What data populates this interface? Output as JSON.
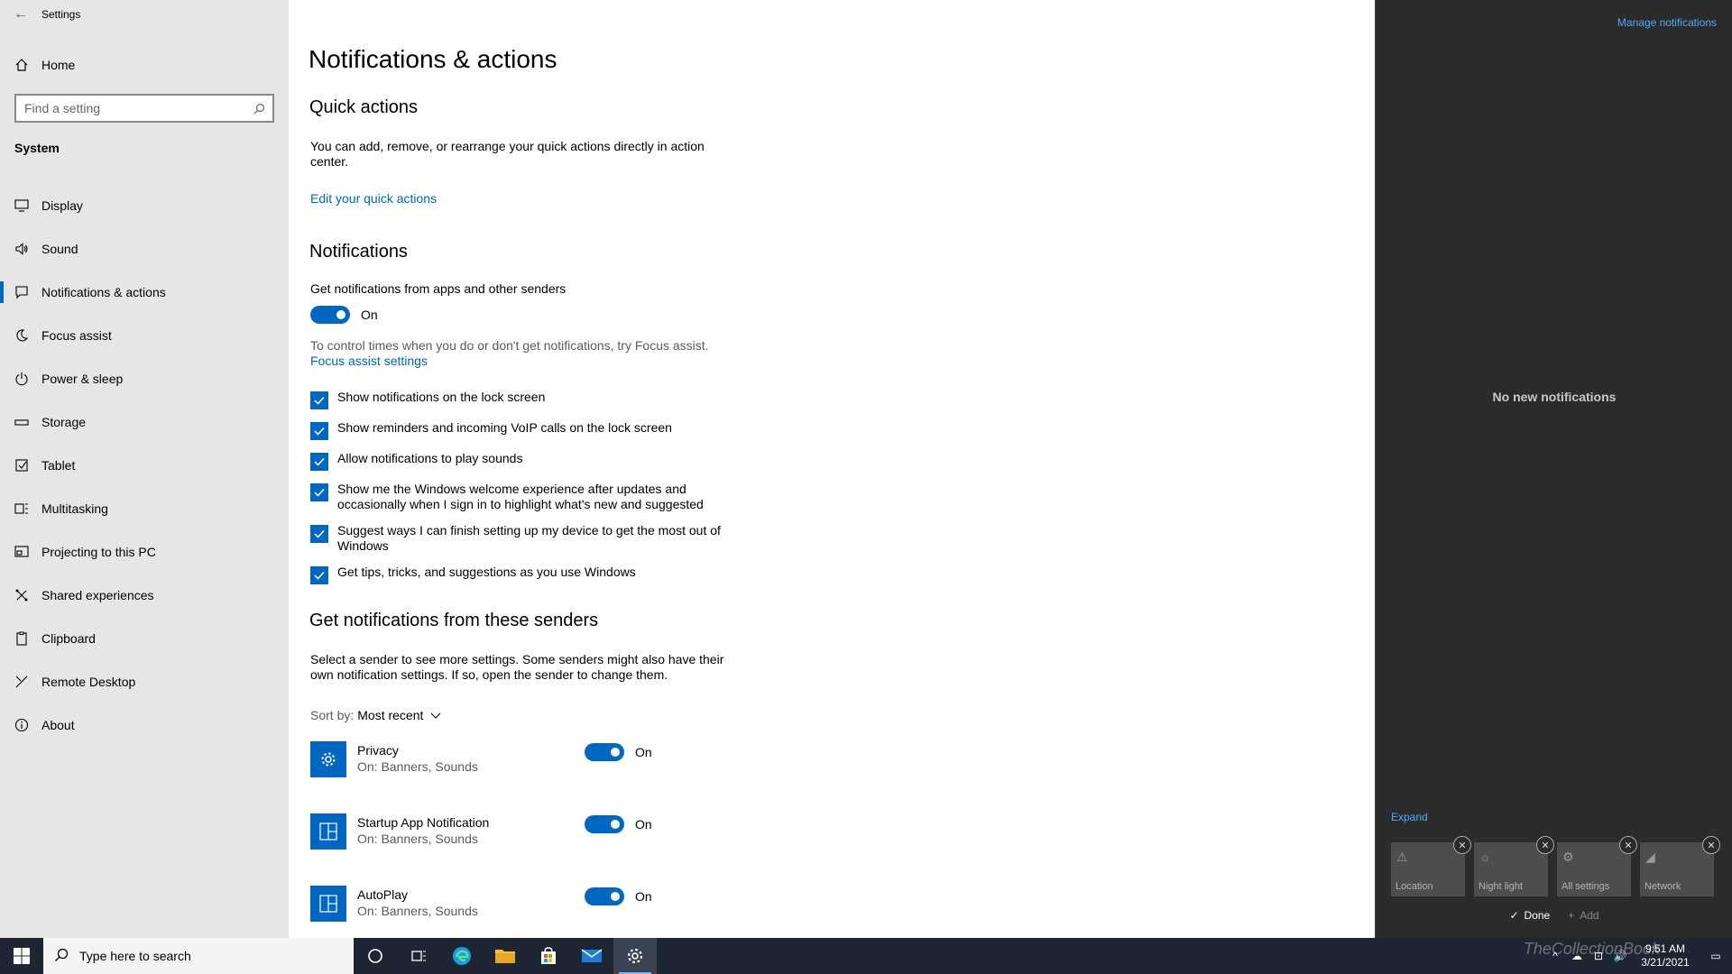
{
  "window": {
    "app_title": "Settings",
    "back_glyph": "←"
  },
  "sidebar": {
    "home_label": "Home",
    "search_placeholder": "Find a setting",
    "section_label": "System",
    "items": [
      {
        "label": "Display",
        "icon": "monitor-icon"
      },
      {
        "label": "Sound",
        "icon": "speaker-icon"
      },
      {
        "label": "Notifications & actions",
        "icon": "message-icon",
        "active": true
      },
      {
        "label": "Focus assist",
        "icon": "moon-icon"
      },
      {
        "label": "Power & sleep",
        "icon": "power-icon"
      },
      {
        "label": "Storage",
        "icon": "drive-icon"
      },
      {
        "label": "Tablet",
        "icon": "tablet-icon"
      },
      {
        "label": "Multitasking",
        "icon": "multitasking-icon"
      },
      {
        "label": "Projecting to this PC",
        "icon": "projector-icon"
      },
      {
        "label": "Shared experiences",
        "icon": "shared-icon"
      },
      {
        "label": "Clipboard",
        "icon": "clipboard-icon"
      },
      {
        "label": "Remote Desktop",
        "icon": "remote-desktop-icon"
      },
      {
        "label": "About",
        "icon": "info-icon"
      }
    ]
  },
  "main": {
    "page_title": "Notifications & actions",
    "quick_actions": {
      "heading": "Quick actions",
      "description": "You can add, remove, or rearrange your quick actions directly in action center.",
      "link": "Edit your quick actions"
    },
    "notifications": {
      "heading": "Notifications",
      "toggle_label": "Get notifications from apps and other senders",
      "toggle_state": "On",
      "focus_text": "To control times when you do or don't get notifications, try Focus assist.",
      "focus_link": "Focus assist settings",
      "checks": [
        "Show notifications on the lock screen",
        "Show reminders and incoming VoIP calls on the lock screen",
        "Allow notifications to play sounds",
        "Show me the Windows welcome experience after updates and occasionally when I sign in to highlight what's new and suggested",
        "Suggest ways I can finish setting up my device to get the most out of Windows",
        "Get tips, tricks, and suggestions as you use Windows"
      ]
    },
    "senders": {
      "heading": "Get notifications from these senders",
      "description": "Select a sender to see more settings. Some senders might also have their own notification settings. If so, open the sender to change them.",
      "sort_label": "Sort by:",
      "sort_value": "Most recent",
      "items": [
        {
          "name": "Privacy",
          "detail": "On: Banners, Sounds",
          "state": "On",
          "icon": "gear-icon"
        },
        {
          "name": "Startup App Notification",
          "detail": "On: Banners, Sounds",
          "state": "On",
          "icon": "app-icon"
        },
        {
          "name": "AutoPlay",
          "detail": "On: Banners, Sounds",
          "state": "On",
          "icon": "app-icon"
        }
      ]
    }
  },
  "action_center": {
    "manage_link": "Manage notifications",
    "empty_text": "No new notifications",
    "expand_link": "Expand",
    "tiles": [
      {
        "label": "Location",
        "icon": "location-icon"
      },
      {
        "label": "Night light",
        "icon": "brightness-icon"
      },
      {
        "label": "All settings",
        "icon": "gear-icon"
      },
      {
        "label": "Network",
        "icon": "network-icon"
      }
    ],
    "done_label": "Done",
    "add_label": "Add"
  },
  "taskbar": {
    "search_placeholder": "Type here to search",
    "time": "9:51 AM",
    "date": "3/21/2021",
    "watermark": "TheCollectionBook"
  }
}
